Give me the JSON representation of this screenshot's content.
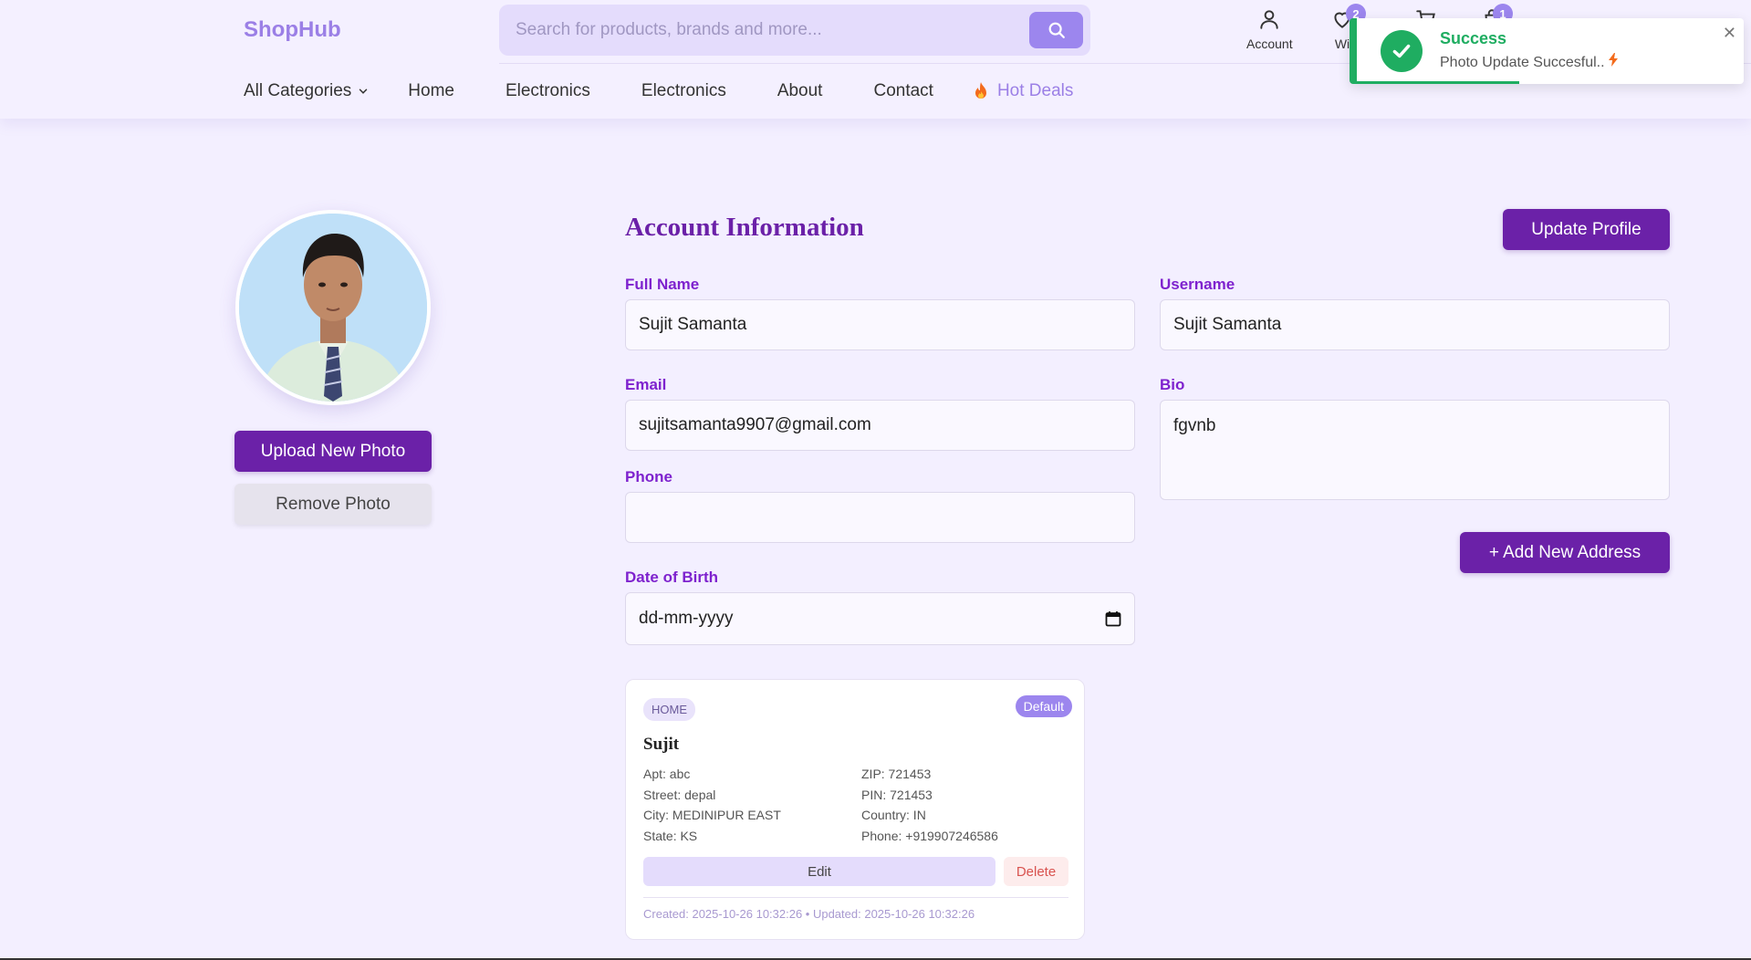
{
  "brand": {
    "name": "ShopHub"
  },
  "search": {
    "placeholder": "Search for products, brands and more..."
  },
  "header_icons": {
    "account_label": "Account",
    "wishlist_label": "Wi",
    "wishlist_count": "2",
    "cart_count": "",
    "orders_count": "1"
  },
  "nav": {
    "all_categories": "All Categories",
    "items": [
      "Home",
      "Electronics",
      "Electronics",
      "About",
      "Contact"
    ],
    "hot_deals": "Hot Deals"
  },
  "toast": {
    "title": "Success",
    "message": "Photo Update Succesful..",
    "progress_fraction": 0.42
  },
  "profile_photo": {
    "upload_label": "Upload New Photo",
    "remove_label": "Remove Photo"
  },
  "account": {
    "title": "Account Information",
    "update_label": "Update Profile",
    "full_name_label": "Full Name",
    "full_name_value": "Sujit Samanta",
    "username_label": "Username",
    "username_value": "Sujit Samanta",
    "email_label": "Email",
    "email_value": "sujitsamanta9907@gmail.com",
    "bio_label": "Bio",
    "bio_value": "fgvnb",
    "phone_label": "Phone",
    "phone_value": "",
    "dob_label": "Date of Birth",
    "dob_placeholder": "dd-mm-yyyy",
    "add_address_label": "+ Add New Address"
  },
  "address": {
    "type": "HOME",
    "default_label": "Default",
    "name": "Sujit",
    "apt": "Apt: abc",
    "street": "Street: depal",
    "city": "City: MEDINIPUR EAST",
    "state": "State: KS",
    "zip": "ZIP: 721453",
    "pin": "PIN: 721453",
    "country": "Country: IN",
    "phone": "Phone: +919907246586",
    "edit_label": "Edit",
    "delete_label": "Delete",
    "meta": "Created: 2025-10-26 10:32:26 • Updated: 2025-10-26 10:32:26"
  },
  "colors": {
    "brand_purple": "#6b21a8",
    "accent_lavender": "#9c86ee",
    "success_green": "#1fad61"
  }
}
